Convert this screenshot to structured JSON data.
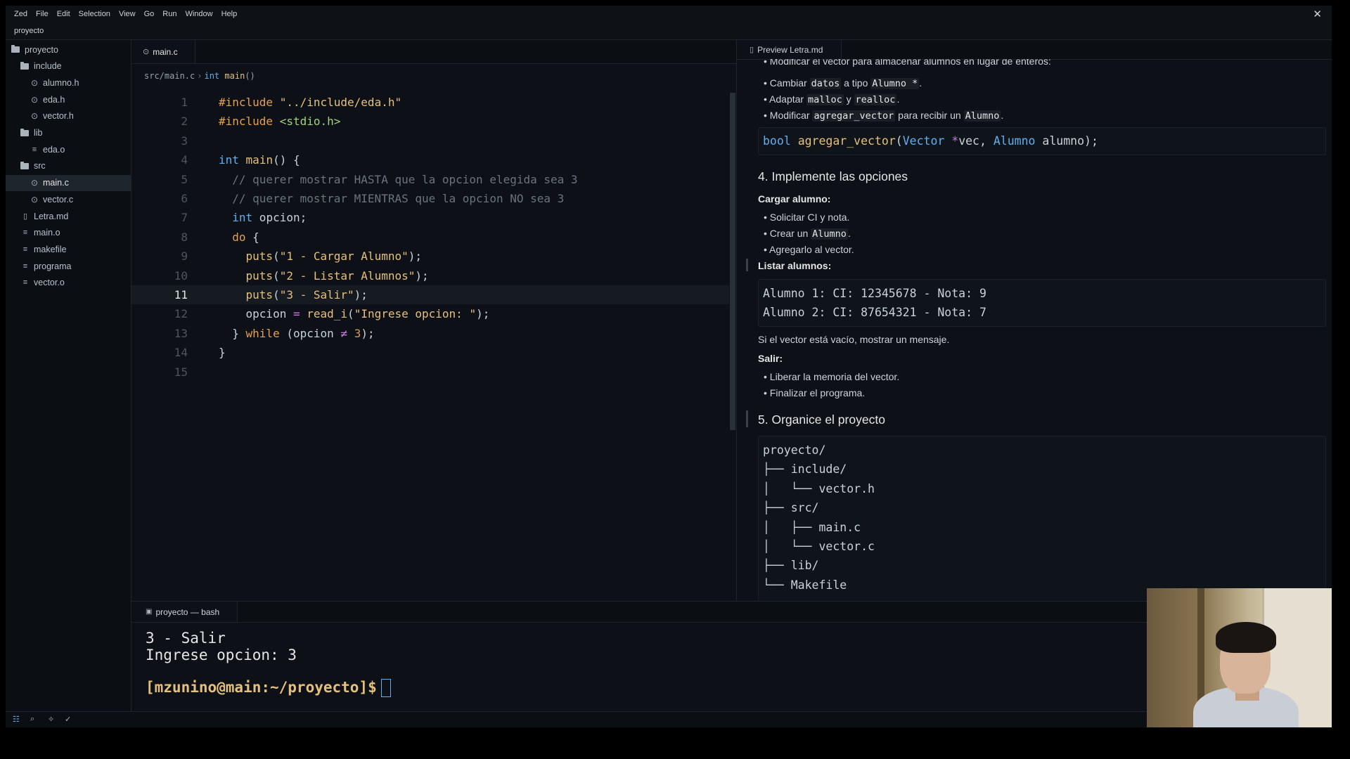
{
  "menubar": {
    "items": [
      "Zed",
      "File",
      "Edit",
      "Selection",
      "View",
      "Go",
      "Run",
      "Window",
      "Help"
    ],
    "close_glyph": "✕"
  },
  "title": "proyecto",
  "sidebar": {
    "items": [
      {
        "label": "proyecto",
        "type": "folder"
      },
      {
        "label": "include",
        "type": "folder"
      },
      {
        "label": "alumno.h",
        "type": "c-file"
      },
      {
        "label": "eda.h",
        "type": "c-file"
      },
      {
        "label": "vector.h",
        "type": "c-file"
      },
      {
        "label": "lib",
        "type": "folder"
      },
      {
        "label": "eda.o",
        "type": "file"
      },
      {
        "label": "src",
        "type": "folder"
      },
      {
        "label": "main.c",
        "type": "c-file",
        "selected": true
      },
      {
        "label": "vector.c",
        "type": "c-file"
      },
      {
        "label": "Letra.md",
        "type": "book-file"
      },
      {
        "label": "main.o",
        "type": "file"
      },
      {
        "label": "makefile",
        "type": "file"
      },
      {
        "label": "programa",
        "type": "file"
      },
      {
        "label": "vector.o",
        "type": "file"
      }
    ]
  },
  "editor": {
    "tab_label": "main.c",
    "breadcrumb": {
      "path": "src/main.c",
      "sep": "›",
      "kw": "int",
      "fn": "main",
      "parens": "()"
    },
    "active_line": 11,
    "code_lines": [
      {
        "n": "1",
        "parts": [
          [
            "k",
            "#include"
          ],
          [
            "t",
            " "
          ],
          [
            "s",
            "\"../include/eda.h\""
          ]
        ]
      },
      {
        "n": "2",
        "parts": [
          [
            "k",
            "#include"
          ],
          [
            "t",
            " "
          ],
          [
            "g",
            "<stdio.h>"
          ]
        ]
      },
      {
        "n": "3",
        "parts": []
      },
      {
        "n": "4",
        "parts": [
          [
            "kb",
            "int"
          ],
          [
            "t",
            " "
          ],
          [
            "f",
            "main"
          ],
          [
            "t",
            "() {"
          ]
        ]
      },
      {
        "n": "5",
        "parts": [
          [
            "c",
            "  // querer mostrar HASTA que la opcion elegida sea 3"
          ]
        ]
      },
      {
        "n": "6",
        "parts": [
          [
            "c",
            "  // querer mostrar MIENTRAS que la opcion NO sea 3"
          ]
        ]
      },
      {
        "n": "7",
        "parts": [
          [
            "t",
            "  "
          ],
          [
            "kb",
            "int"
          ],
          [
            "t",
            " opcion;"
          ]
        ]
      },
      {
        "n": "8",
        "parts": [
          [
            "t",
            "  "
          ],
          [
            "k",
            "do"
          ],
          [
            "t",
            " {"
          ]
        ]
      },
      {
        "n": "9",
        "parts": [
          [
            "t",
            "    "
          ],
          [
            "f",
            "puts"
          ],
          [
            "t",
            "("
          ],
          [
            "s",
            "\"1 - Cargar Alumno\""
          ],
          [
            "t",
            ");"
          ]
        ]
      },
      {
        "n": "10",
        "parts": [
          [
            "t",
            "    "
          ],
          [
            "f",
            "puts"
          ],
          [
            "t",
            "("
          ],
          [
            "s",
            "\"2 - Listar Alumnos\""
          ],
          [
            "t",
            ");"
          ]
        ]
      },
      {
        "n": "11",
        "parts": [
          [
            "t",
            "    "
          ],
          [
            "f",
            "puts"
          ],
          [
            "t",
            "("
          ],
          [
            "s",
            "\"3 - Salir\""
          ],
          [
            "t",
            ");"
          ]
        ]
      },
      {
        "n": "12",
        "parts": [
          [
            "t",
            "    opcion "
          ],
          [
            "o",
            "="
          ],
          [
            "t",
            " "
          ],
          [
            "f",
            "read_i"
          ],
          [
            "t",
            "("
          ],
          [
            "s",
            "\"Ingrese opcion: \""
          ],
          [
            "t",
            ");"
          ]
        ]
      },
      {
        "n": "13",
        "parts": [
          [
            "t",
            "  } "
          ],
          [
            "k",
            "while"
          ],
          [
            "t",
            " (opcion "
          ],
          [
            "o",
            "≠"
          ],
          [
            "t",
            " "
          ],
          [
            "n",
            "3"
          ],
          [
            "t",
            ");"
          ]
        ]
      },
      {
        "n": "14",
        "parts": [
          [
            "t",
            "}"
          ]
        ]
      },
      {
        "n": "15",
        "parts": []
      }
    ]
  },
  "preview": {
    "tab_label": "Preview Letra.md",
    "partial_top": "Modificar el vector para almacenar alumnos en lugar de enteros:",
    "list1": [
      [
        [
          "t",
          "Cambiar "
        ],
        [
          "code",
          "datos"
        ],
        [
          "t",
          " a tipo "
        ],
        [
          "code",
          "Alumno *"
        ],
        [
          "t",
          "."
        ]
      ],
      [
        [
          "t",
          "Adaptar "
        ],
        [
          "code",
          "malloc"
        ],
        [
          "t",
          " y "
        ],
        [
          "code",
          "realloc"
        ],
        [
          "t",
          "."
        ]
      ],
      [
        [
          "t",
          "Modificar "
        ],
        [
          "code",
          "agregar_vector"
        ],
        [
          "t",
          " para recibir un "
        ],
        [
          "code",
          "Alumno"
        ],
        [
          "t",
          "."
        ]
      ]
    ],
    "signature": [
      [
        "kb",
        "bool"
      ],
      [
        "t",
        " "
      ],
      [
        "f",
        "agregar_vector"
      ],
      [
        "t",
        "("
      ],
      [
        "kb",
        "Vector"
      ],
      [
        "t",
        " "
      ],
      [
        "o",
        "*"
      ],
      [
        "t",
        "vec, "
      ],
      [
        "kb",
        "Alumno"
      ],
      [
        "t",
        " alumno);"
      ]
    ],
    "h_options": "4. Implemente las opciones",
    "cargar_label": "Cargar alumno:",
    "cargar_items": [
      [
        [
          "t",
          "Solicitar CI y nota."
        ]
      ],
      [
        [
          "t",
          "Crear un "
        ],
        [
          "code",
          "Alumno"
        ],
        [
          "t",
          "."
        ]
      ],
      [
        [
          "t",
          "Agregarlo al vector."
        ]
      ]
    ],
    "listar_label": "Listar alumnos:",
    "listar_output": [
      "Alumno 1: CI: 12345678 - Nota: 9",
      "Alumno 2: CI: 87654321 - Nota: 7"
    ],
    "empty_msg": "Si el vector está vacío, mostrar un mensaje.",
    "salir_label": "Salir:",
    "salir_items": [
      [
        [
          "t",
          "Liberar la memoria del vector."
        ]
      ],
      [
        [
          "t",
          "Finalizar el programa."
        ]
      ]
    ],
    "h_org": "5. Organice el proyecto",
    "tree": [
      "proyecto/",
      "├── include/",
      "│   └── vector.h",
      "├── src/",
      "│   ├── main.c",
      "│   └── vector.c",
      "├── lib/",
      "└── Makefile"
    ]
  },
  "terminal": {
    "tab_label": "proyecto — bash",
    "lines": [
      "3 - Salir",
      "Ingrese opcion: 3",
      ""
    ],
    "prompt": "[mzunino@main:~/proyecto]$"
  },
  "statusbar": {
    "icons": [
      "project-panel-icon",
      "search-icon",
      "ai-icon",
      "check-icon"
    ]
  }
}
